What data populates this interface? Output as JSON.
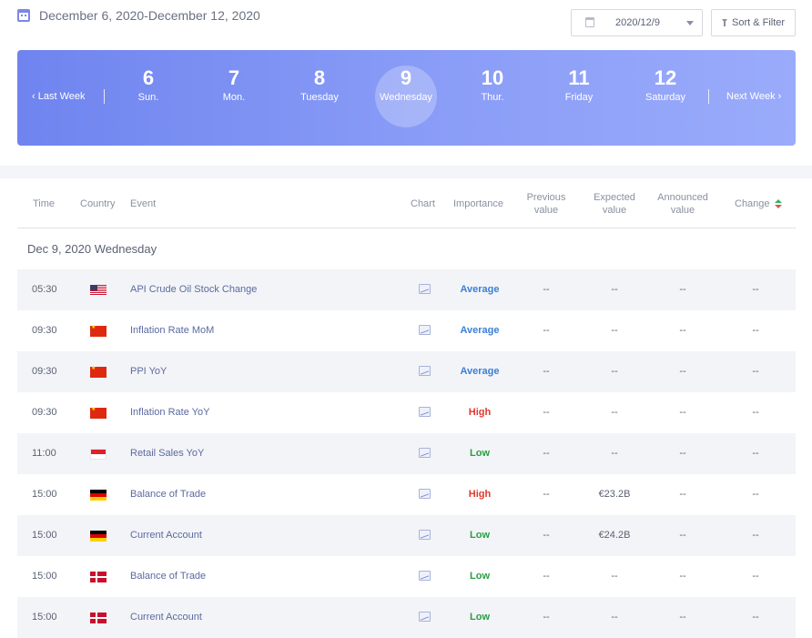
{
  "header": {
    "range_title": "December 6, 2020-December 12, 2020",
    "date_value": "2020/12/9",
    "sort_filter_label": "Sort & Filter"
  },
  "week": {
    "prev_label": "Last Week",
    "next_label": "Next Week",
    "days": [
      {
        "num": "6",
        "name": "Sun."
      },
      {
        "num": "7",
        "name": "Mon."
      },
      {
        "num": "8",
        "name": "Tuesday"
      },
      {
        "num": "9",
        "name": "Wednesday",
        "active": true
      },
      {
        "num": "10",
        "name": "Thur."
      },
      {
        "num": "11",
        "name": "Friday"
      },
      {
        "num": "12",
        "name": "Saturday"
      }
    ]
  },
  "table": {
    "columns": {
      "time": "Time",
      "country": "Country",
      "event": "Event",
      "chart": "Chart",
      "importance": "Importance",
      "previous_1": "Previous",
      "previous_2": "value",
      "expected_1": "Expected",
      "expected_2": "value",
      "announced_1": "Announced",
      "announced_2": "value",
      "change": "Change"
    },
    "day_heading": "Dec 9, 2020 Wednesday",
    "rows": [
      {
        "time": "05:30",
        "flag": "us",
        "event": "API Crude Oil Stock Change",
        "importance": "Average",
        "previous": "--",
        "expected": "--",
        "announced": "--",
        "change": "--"
      },
      {
        "time": "09:30",
        "flag": "cn",
        "event": "Inflation Rate MoM",
        "importance": "Average",
        "previous": "--",
        "expected": "--",
        "announced": "--",
        "change": "--"
      },
      {
        "time": "09:30",
        "flag": "cn",
        "event": "PPI YoY",
        "importance": "Average",
        "previous": "--",
        "expected": "--",
        "announced": "--",
        "change": "--"
      },
      {
        "time": "09:30",
        "flag": "cn",
        "event": "Inflation Rate YoY",
        "importance": "High",
        "previous": "--",
        "expected": "--",
        "announced": "--",
        "change": "--"
      },
      {
        "time": "11:00",
        "flag": "id",
        "event": "Retail Sales YoY",
        "importance": "Low",
        "previous": "--",
        "expected": "--",
        "announced": "--",
        "change": "--"
      },
      {
        "time": "15:00",
        "flag": "de",
        "event": "Balance of Trade",
        "importance": "High",
        "previous": "--",
        "expected": "€23.2B",
        "announced": "--",
        "change": "--"
      },
      {
        "time": "15:00",
        "flag": "de",
        "event": "Current Account",
        "importance": "Low",
        "previous": "--",
        "expected": "€24.2B",
        "announced": "--",
        "change": "--"
      },
      {
        "time": "15:00",
        "flag": "dk",
        "event": "Balance of Trade",
        "importance": "Low",
        "previous": "--",
        "expected": "--",
        "announced": "--",
        "change": "--"
      },
      {
        "time": "15:00",
        "flag": "dk",
        "event": "Current Account",
        "importance": "Low",
        "previous": "--",
        "expected": "--",
        "announced": "--",
        "change": "--"
      }
    ]
  },
  "colors": {
    "accent": "#7c86e8",
    "banner_start": "#6f84ef",
    "banner_end": "#9aabfb",
    "importance_average": "#3b7fd8",
    "importance_high": "#e0392f",
    "importance_low": "#2a9d43"
  }
}
